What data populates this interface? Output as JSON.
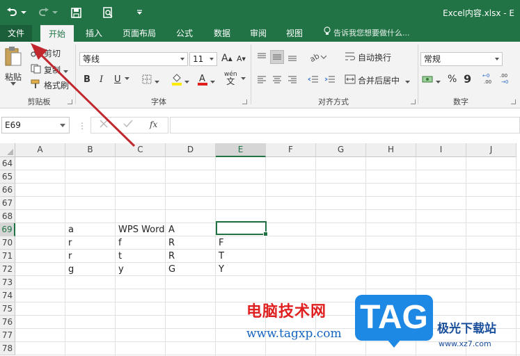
{
  "window": {
    "title": "Excel内容.xlsx - E"
  },
  "quick_access": {
    "undo_icon": "undo-icon",
    "redo_icon": "redo-icon",
    "save_icon": "save-icon",
    "preview_icon": "print-preview-icon",
    "more_icon": "customize-icon"
  },
  "tabs": [
    {
      "label": "文件"
    },
    {
      "label": "开始"
    },
    {
      "label": "插入"
    },
    {
      "label": "页面布局"
    },
    {
      "label": "公式"
    },
    {
      "label": "数据"
    },
    {
      "label": "审阅"
    },
    {
      "label": "视图"
    }
  ],
  "tell_me": "告诉我您想要做什么...",
  "clipboard": {
    "paste": "粘贴",
    "cut": "剪切",
    "copy": "复制",
    "format_painter": "格式刷",
    "label": "剪贴板"
  },
  "font": {
    "name": "等线",
    "size": "11",
    "bold": "B",
    "italic": "I",
    "underline": "U",
    "wen": "wén",
    "wen_char": "文",
    "grow": "A",
    "shrink": "A",
    "label": "字体"
  },
  "alignment": {
    "wrap": "自动换行",
    "merge": "合并后居中",
    "label": "对齐方式"
  },
  "number": {
    "format": "常规",
    "percent": "%",
    "comma": "9",
    "label": "数字"
  },
  "formula_bar": {
    "name_box": "E69",
    "fx": "fx",
    "value": ""
  },
  "columns": [
    "A",
    "B",
    "C",
    "D",
    "E",
    "F",
    "G",
    "H",
    "I",
    "J"
  ],
  "rows": [
    "64",
    "65",
    "66",
    "67",
    "68",
    "69",
    "70",
    "71",
    "72",
    "73",
    "74",
    "75",
    "76",
    "77",
    "78"
  ],
  "cells": {
    "r69": {
      "B": "a",
      "C": "WPS Word",
      "D": "A",
      "E": ""
    },
    "r70": {
      "B": "r",
      "C": "f",
      "D": "R",
      "E": "F"
    },
    "r71": {
      "B": "r",
      "C": "t",
      "D": "R",
      "E": "T"
    },
    "r72": {
      "B": "g",
      "C": "y",
      "D": "G",
      "E": "Y"
    }
  },
  "selected_cell": "E69",
  "watermark": {
    "cn": "电脑技术网",
    "url": "www.tagxp.com",
    "tag": "TAG",
    "site2": "极光下载站",
    "site2_url": "www.xz7.com"
  },
  "colors": {
    "excel_green": "#217346",
    "arrow_red": "#c0282e"
  }
}
